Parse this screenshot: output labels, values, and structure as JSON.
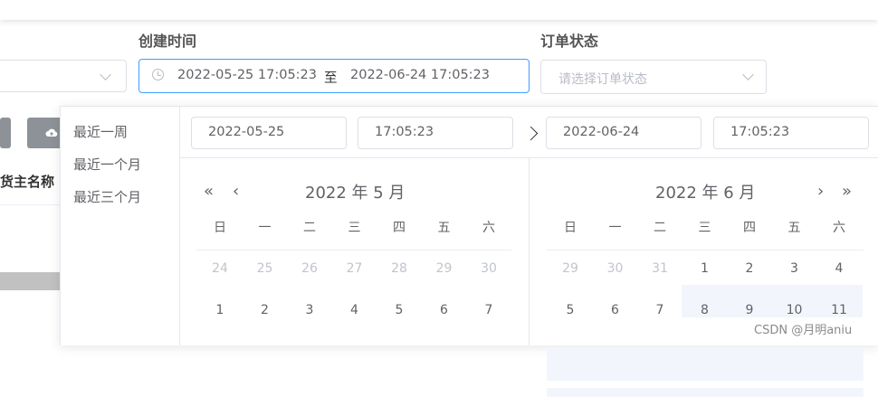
{
  "filters": {
    "created_time_label": "创建时间",
    "order_status_label": "订单状态",
    "order_status_placeholder": "请选择订单状态",
    "range_start": "2022-05-25 17:05:23",
    "range_separator": "至",
    "range_end": "2022-06-24 17:05:23"
  },
  "table": {
    "col_owner_name": "货主名称"
  },
  "picker": {
    "shortcuts": [
      "最近一周",
      "最近一个月",
      "最近三个月"
    ],
    "start_date": "2022-05-25",
    "start_time": "17:05:23",
    "end_date": "2022-06-24",
    "end_time": "17:05:23",
    "left_title": "2022 年 5 月",
    "right_title": "2022 年 6 月",
    "weekdays": [
      "日",
      "一",
      "二",
      "三",
      "四",
      "五",
      "六"
    ],
    "left_rows": [
      [
        "24",
        "25",
        "26",
        "27",
        "28",
        "29",
        "30"
      ],
      [
        "1",
        "2",
        "3",
        "4",
        "5",
        "6",
        "7"
      ]
    ],
    "right_rows": [
      [
        "29",
        "30",
        "31",
        "1",
        "2",
        "3",
        "4"
      ],
      [
        "5",
        "6",
        "7",
        "8",
        "9",
        "10",
        "11"
      ]
    ],
    "nav": {
      "prev_year": "«",
      "prev_month": "‹",
      "next_month": "›",
      "next_year": "»"
    }
  },
  "watermark": "CSDN @月明aniu",
  "colors": {
    "accent": "#409eff",
    "range_bg": "#f2f6fc",
    "button_gray": "#8d9299"
  }
}
